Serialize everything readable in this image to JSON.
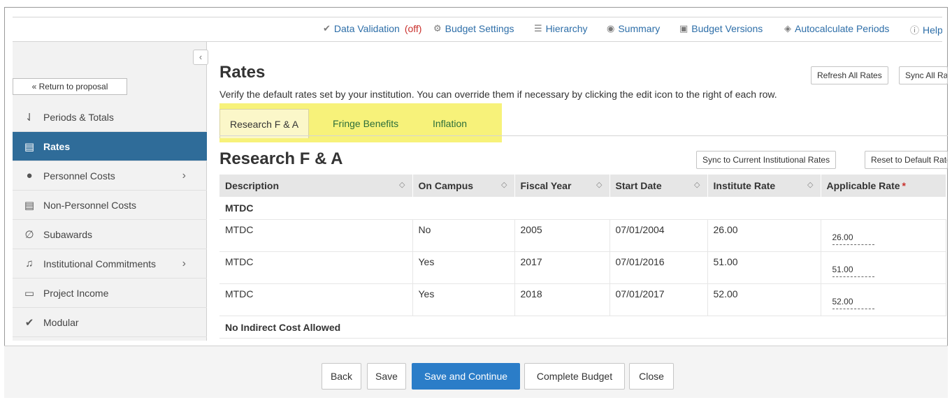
{
  "toolbar": {
    "data_validation": "Data Validation",
    "data_validation_state": "(off)",
    "budget_settings": "Budget Settings",
    "hierarchy": "Hierarchy",
    "summary": "Summary",
    "budget_versions": "Budget Versions",
    "autocalculate": "Autocalculate Periods",
    "help": "Help"
  },
  "sidebar": {
    "collapse": "‹",
    "return": "« Return to proposal",
    "items": [
      {
        "label": "Periods & Totals",
        "icon": "periods-icon"
      },
      {
        "label": "Rates",
        "icon": "rates-icon"
      },
      {
        "label": "Personnel Costs",
        "icon": "person-icon",
        "chevron": "›"
      },
      {
        "label": "Non-Personnel Costs",
        "icon": "document-icon"
      },
      {
        "label": "Subawards",
        "icon": "paperclip-icon"
      },
      {
        "label": "Institutional Commitments",
        "icon": "bell-icon",
        "chevron": "›"
      },
      {
        "label": "Project Income",
        "icon": "money-icon"
      },
      {
        "label": "Modular",
        "icon": "check-icon"
      }
    ]
  },
  "main": {
    "title": "Rates",
    "refresh_all": "Refresh All Rates",
    "sync_all": "Sync All Rates",
    "subtitle": "Verify the default rates set by your institution. You can override them if necessary by clicking the edit icon to the right of each row.",
    "tabs": [
      "Research F & A",
      "Fringe Benefits",
      "Inflation"
    ],
    "section_title": "Research F & A",
    "sync_current": "Sync to Current Institutional Rates",
    "reset_default": "Reset to Default Rates",
    "table": {
      "headers": [
        "Description",
        "On Campus",
        "Fiscal Year",
        "Start Date",
        "Institute Rate",
        "Applicable Rate"
      ],
      "required_mark": "*",
      "group1": "MTDC",
      "rows": [
        {
          "desc": "MTDC",
          "campus": "No",
          "year": "2005",
          "start": "07/01/2004",
          "inst": "26.00",
          "applicable": "26.00"
        },
        {
          "desc": "MTDC",
          "campus": "Yes",
          "year": "2017",
          "start": "07/01/2016",
          "inst": "51.00",
          "applicable": "51.00"
        },
        {
          "desc": "MTDC",
          "campus": "Yes",
          "year": "2018",
          "start": "07/01/2017",
          "inst": "52.00",
          "applicable": "52.00"
        }
      ],
      "group2": "No Indirect Cost Allowed"
    }
  },
  "footer": {
    "back": "Back",
    "save": "Save",
    "save_continue": "Save and Continue",
    "complete": "Complete Budget",
    "close": "Close"
  },
  "colors": {
    "accent": "#2f6c99",
    "primary_button": "#2b7dc8",
    "tab_highlight": "#f7f27a",
    "link": "#2d6ea8",
    "off": "#c9302c"
  }
}
